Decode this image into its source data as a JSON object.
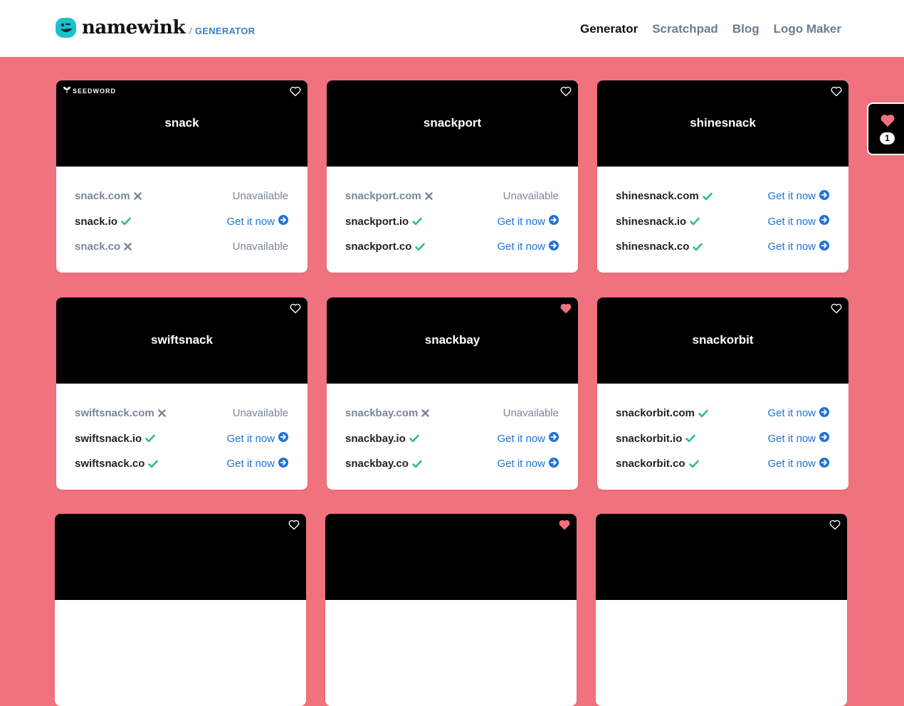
{
  "header": {
    "logo_text": "namewink",
    "logo_sub": "GENERATOR",
    "nav": [
      {
        "label": "Generator",
        "active": true
      },
      {
        "label": "Scratchpad",
        "active": false
      },
      {
        "label": "Blog",
        "active": false
      },
      {
        "label": "Logo Maker",
        "active": false
      }
    ]
  },
  "badge_label": "SEEDWORD",
  "favorites": {
    "count": "1"
  },
  "colors": {
    "background": "#f0727f",
    "available": "#2ebd85",
    "taken": "#7a8596",
    "link": "#1e73d6",
    "heart_active": "#f0727f"
  },
  "cards": [
    {
      "name": "snack",
      "seedword": true,
      "favorited": false,
      "domains": [
        {
          "domain": "snack.com",
          "available": false,
          "status": "Unavailable"
        },
        {
          "domain": "snack.io",
          "available": true,
          "status": "Get it now"
        },
        {
          "domain": "snack.co",
          "available": false,
          "status": "Unavailable"
        }
      ]
    },
    {
      "name": "snackport",
      "seedword": false,
      "favorited": false,
      "domains": [
        {
          "domain": "snackport.com",
          "available": false,
          "status": "Unavailable"
        },
        {
          "domain": "snackport.io",
          "available": true,
          "status": "Get it now"
        },
        {
          "domain": "snackport.co",
          "available": true,
          "status": "Get it now"
        }
      ]
    },
    {
      "name": "shinesnack",
      "seedword": false,
      "favorited": false,
      "domains": [
        {
          "domain": "shinesnack.com",
          "available": true,
          "status": "Get it now"
        },
        {
          "domain": "shinesnack.io",
          "available": true,
          "status": "Get it now"
        },
        {
          "domain": "shinesnack.co",
          "available": true,
          "status": "Get it now"
        }
      ]
    },
    {
      "name": "swiftsnack",
      "seedword": false,
      "favorited": false,
      "domains": [
        {
          "domain": "swiftsnack.com",
          "available": false,
          "status": "Unavailable"
        },
        {
          "domain": "swiftsnack.io",
          "available": true,
          "status": "Get it now"
        },
        {
          "domain": "swiftsnack.co",
          "available": true,
          "status": "Get it now"
        }
      ]
    },
    {
      "name": "snackbay",
      "seedword": false,
      "favorited": true,
      "domains": [
        {
          "domain": "snackbay.com",
          "available": false,
          "status": "Unavailable"
        },
        {
          "domain": "snackbay.io",
          "available": true,
          "status": "Get it now"
        },
        {
          "domain": "snackbay.co",
          "available": true,
          "status": "Get it now"
        }
      ]
    },
    {
      "name": "snackorbit",
      "seedword": false,
      "favorited": false,
      "domains": [
        {
          "domain": "snackorbit.com",
          "available": true,
          "status": "Get it now"
        },
        {
          "domain": "snackorbit.io",
          "available": true,
          "status": "Get it now"
        },
        {
          "domain": "snackorbit.co",
          "available": true,
          "status": "Get it now"
        }
      ]
    },
    {
      "name": "",
      "seedword": false,
      "favorited": false,
      "domains": []
    },
    {
      "name": "",
      "seedword": false,
      "favorited": true,
      "domains": []
    },
    {
      "name": "",
      "seedword": false,
      "favorited": false,
      "domains": []
    }
  ]
}
